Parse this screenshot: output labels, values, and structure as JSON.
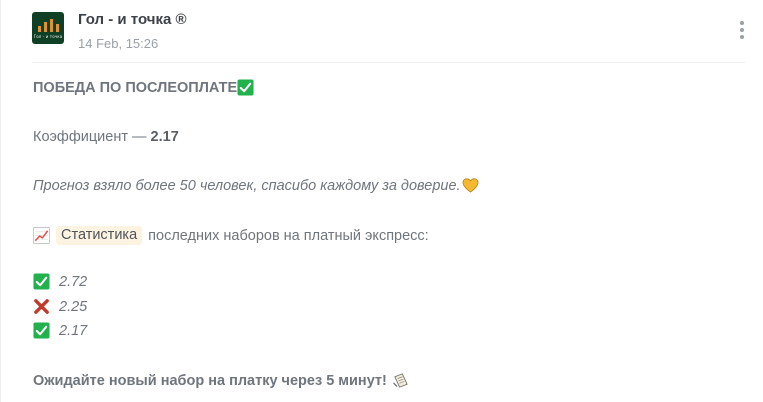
{
  "post": {
    "channel_name": "Гол - и точка ®",
    "timestamp": "14 Feb, 15:26",
    "avatar_text": "Гол - и точка",
    "menu_icon": "more-vertical-icon"
  },
  "message": {
    "headline": "ПОБЕДА ПО ПОСЛЕОПЛАТЕ",
    "odds_label": "Коэффициент — ",
    "odds_value": "2.17",
    "thanks_text": "Прогноз взяло более 50 человек, спасибо каждому за доверие.",
    "stats_tag": "Статистика",
    "stats_text": "последних наборов на платный экспресс:",
    "results": [
      {
        "value": "2.72",
        "status": "win",
        "icon": "check-mark-icon"
      },
      {
        "value": "2.25",
        "status": "loss",
        "icon": "cross-mark-icon"
      },
      {
        "value": "2.17",
        "status": "win",
        "icon": "check-mark-icon"
      }
    ],
    "footer_text": "Ожидайте новый набор на платку через 5 минут!"
  },
  "colors": {
    "win": "#22b14c",
    "loss": "#c0392b",
    "text": "#6f757c",
    "title": "#3d4148",
    "chip_bg": "#fdf3e1"
  }
}
